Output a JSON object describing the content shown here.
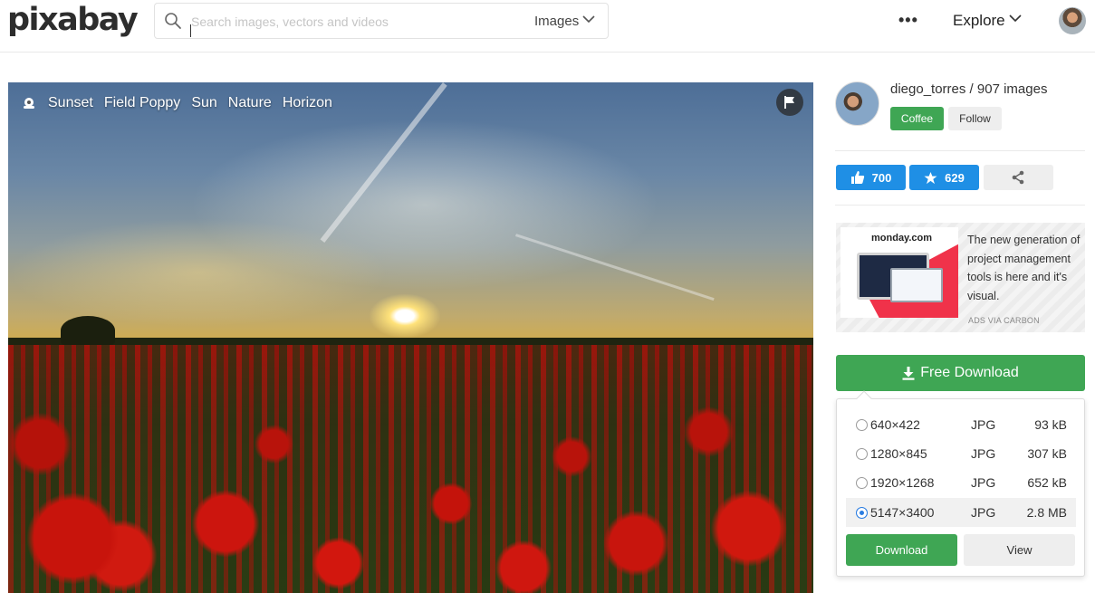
{
  "header": {
    "logo": "pixabay",
    "search": {
      "placeholder": "Search images, vectors and videos",
      "type_label": "Images"
    },
    "more_label": "•••",
    "explore_label": "Explore"
  },
  "photo": {
    "tags": [
      "Sunset",
      "Field Poppy",
      "Sun",
      "Nature",
      "Horizon"
    ]
  },
  "author": {
    "name_line": "diego_torres / 907 images",
    "coffee_label": "Coffee",
    "follow_label": "Follow"
  },
  "stats": {
    "likes": "700",
    "favorites": "629"
  },
  "ad": {
    "brand": "monday.com",
    "text": "The new generation of project management tools is here and it's visual.",
    "via": "ADS VIA CARBON"
  },
  "download": {
    "free_label": "Free Download",
    "options": [
      {
        "dims": "640×422",
        "format": "JPG",
        "size": "93 kB",
        "selected": false
      },
      {
        "dims": "1280×845",
        "format": "JPG",
        "size": "307 kB",
        "selected": false
      },
      {
        "dims": "1920×1268",
        "format": "JPG",
        "size": "652 kB",
        "selected": false
      },
      {
        "dims": "5147×3400",
        "format": "JPG",
        "size": "2.8 MB",
        "selected": true
      }
    ],
    "download_label": "Download",
    "view_label": "View"
  },
  "colors": {
    "green": "#3fa654",
    "blue": "#1f8fe5",
    "radio_blue": "#2a7de1"
  },
  "icons": [
    "search-icon",
    "chevron-down-icon",
    "tag-icon",
    "flag-icon",
    "thumbs-up-icon",
    "star-icon",
    "share-icon",
    "download-arrow-icon"
  ]
}
